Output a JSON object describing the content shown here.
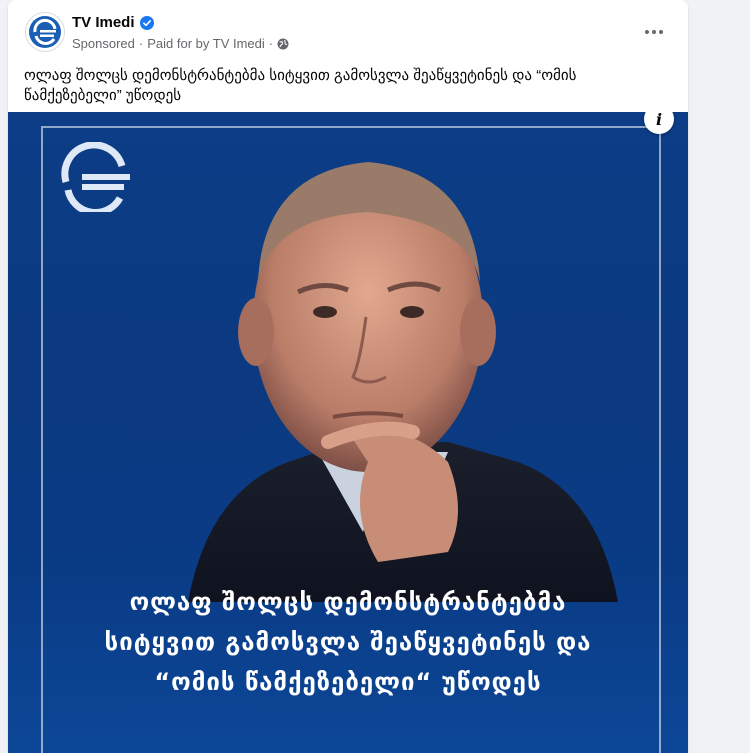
{
  "post": {
    "page_name": "TV Imedi",
    "sponsored_label": "Sponsored",
    "separator": "·",
    "paid_for": "Paid for by TV Imedi",
    "caption": "ოლაფ შოლცს დემონსტრანტებმა სიტყვით გამოსვლა შეაწყვეტინეს და “ომის წამქეზებელი” უწოდეს"
  },
  "media": {
    "info_label": "i",
    "headline_lines": [
      "ოლაფ შოლცს დემონსტრანტებმა",
      "სიტყვით გამოსვლა შეაწყვეტინეს და",
      "“ომის წამქეზებელი“ უწოდეს"
    ]
  },
  "colors": {
    "brand_blue": "#0c3d86",
    "verified_blue": "#1877f2",
    "secondary_text": "#65676b"
  },
  "icons": {
    "verified": "verified-badge-icon",
    "globe": "globe-icon",
    "more": "more-horizontal-icon",
    "info": "info-icon"
  }
}
